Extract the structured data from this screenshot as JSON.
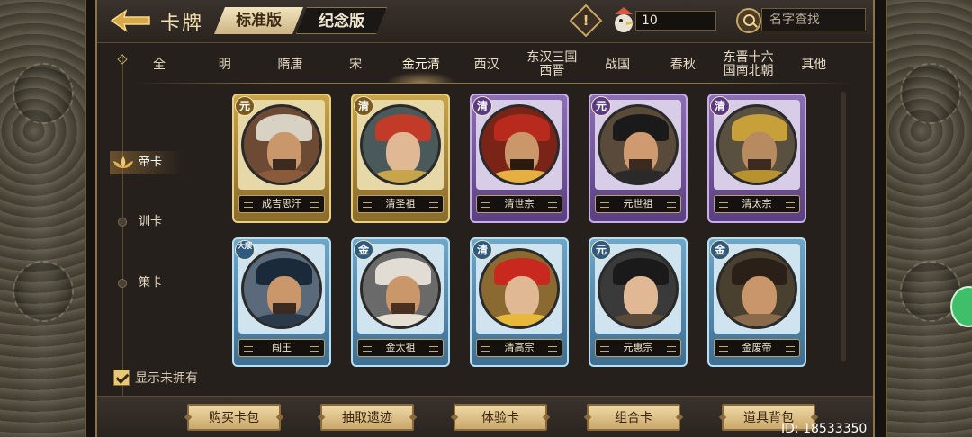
{
  "header": {
    "title": "卡牌",
    "edition_tabs": [
      {
        "label": "标准版",
        "active": true
      },
      {
        "label": "纪念版",
        "active": false
      }
    ],
    "currency_count": "10",
    "search_placeholder": "名字查找"
  },
  "dynasty_tabs": [
    "全",
    "明",
    "隋唐",
    "宋",
    "金元清",
    "西汉",
    "东汉三国西晋",
    "战国",
    "春秋",
    "东晋十六国南北朝",
    "其他"
  ],
  "dynasty_active": "金元清",
  "categories": [
    {
      "label": "帝卡",
      "active": true
    },
    {
      "label": "训卡",
      "active": false
    },
    {
      "label": "策卡",
      "active": false
    }
  ],
  "show_unowned": {
    "label": "显示未拥有",
    "checked": true
  },
  "cards": [
    {
      "name": "成吉思汗",
      "badge": "元",
      "frame": "gold"
    },
    {
      "name": "清圣祖",
      "badge": "清",
      "frame": "gold"
    },
    {
      "name": "清世宗",
      "badge": "清",
      "frame": "purple"
    },
    {
      "name": "元世祖",
      "badge": "元",
      "frame": "purple"
    },
    {
      "name": "清太宗",
      "badge": "清",
      "frame": "purple"
    },
    {
      "name": "闯王",
      "badge": "大顺",
      "frame": "blue"
    },
    {
      "name": "金太祖",
      "badge": "金",
      "frame": "blue"
    },
    {
      "name": "清高宗",
      "badge": "清",
      "frame": "blue"
    },
    {
      "name": "元惠宗",
      "badge": "元",
      "frame": "blue"
    },
    {
      "name": "金废帝",
      "badge": "金",
      "frame": "blue"
    }
  ],
  "buttons": [
    "购买卡包",
    "抽取遗迹",
    "体验卡",
    "组合卡",
    "道具背包"
  ],
  "user_id": "ID: 18533350",
  "colors": {
    "accent_gold": "#c9a765",
    "background": "#26201c"
  }
}
